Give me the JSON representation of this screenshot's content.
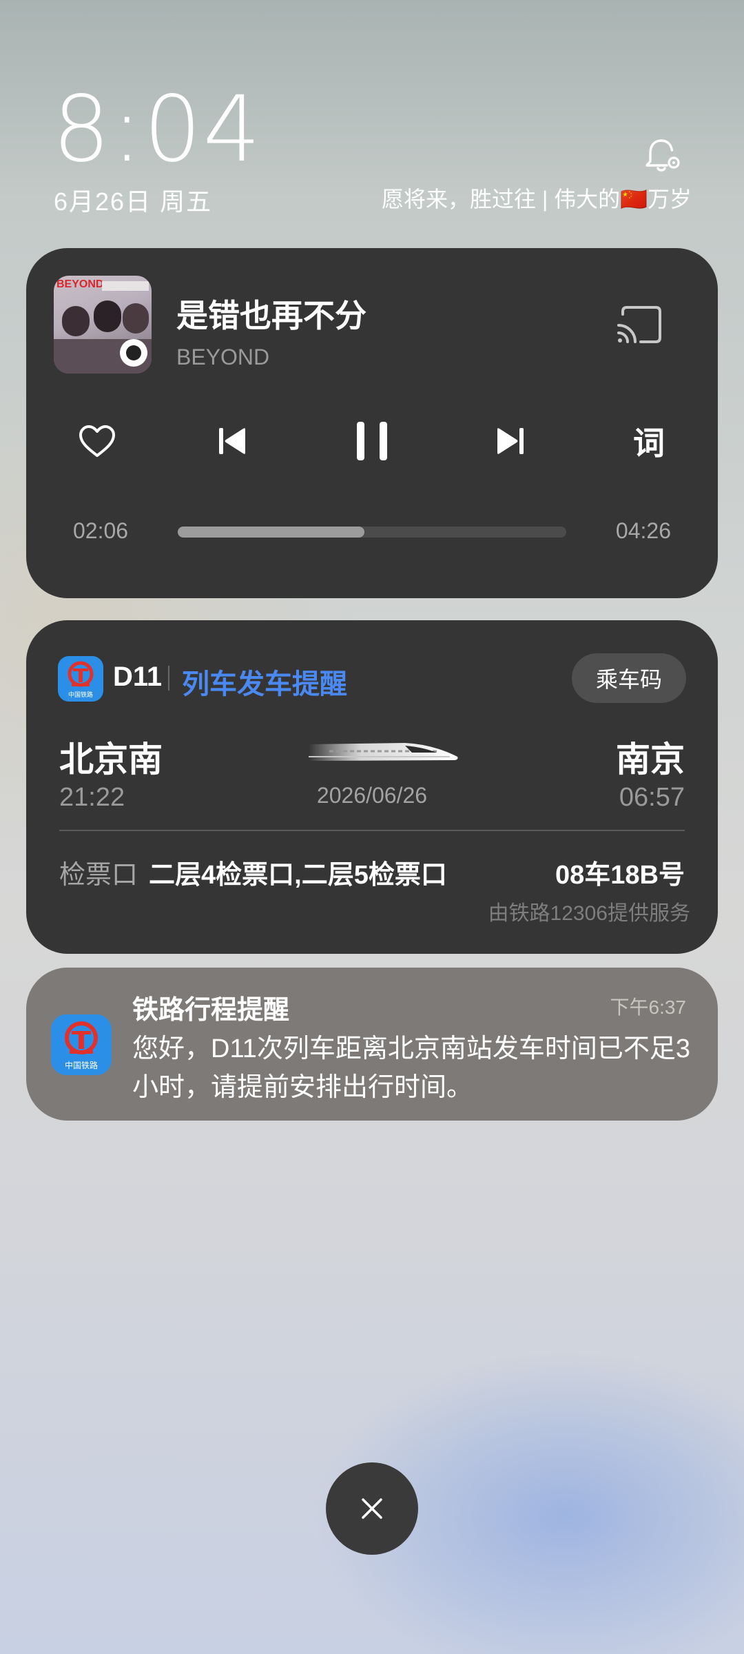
{
  "header": {
    "time": "8:04",
    "date": "6月26日 周五",
    "motto": "愿将来，胜过往 | 伟大的🇨🇳万岁",
    "bell_icon": "bell-settings-icon"
  },
  "music": {
    "title": "是错也再不分",
    "artist": "BEYOND",
    "album_text": "BEYOND",
    "current_time": "02:06",
    "total_time": "04:26",
    "progress": 0.48,
    "lyrics_label": "词",
    "icons": [
      "heart-icon",
      "previous-icon",
      "pause-icon",
      "next-icon",
      "cast-icon"
    ]
  },
  "train": {
    "number": "D11",
    "title": "列车发车提醒",
    "ride_code_label": "乘车码",
    "from_station": "北京南",
    "to_station": "南京",
    "departure_time": "21:22",
    "arrival_time": "06:57",
    "date": "2026/06/26",
    "gate_label": "检票口",
    "gate_value": "二层4检票口,二层5检票口",
    "seat": "08车18B号",
    "provider": "由铁路12306提供服务",
    "app_icon_caption": "中国铁路"
  },
  "notice": {
    "title": "铁路行程提醒",
    "time": "下午6:37",
    "body": "您好，D11次列车距离北京南站发车时间已不足3小时，请提前安排出行时间。",
    "app_icon_caption": "中国铁路"
  },
  "colors": {
    "card_bg": "#353535",
    "accent_blue": "#4b89f2",
    "railway_blue": "#2b8fe8",
    "railway_red": "#e0312b"
  }
}
